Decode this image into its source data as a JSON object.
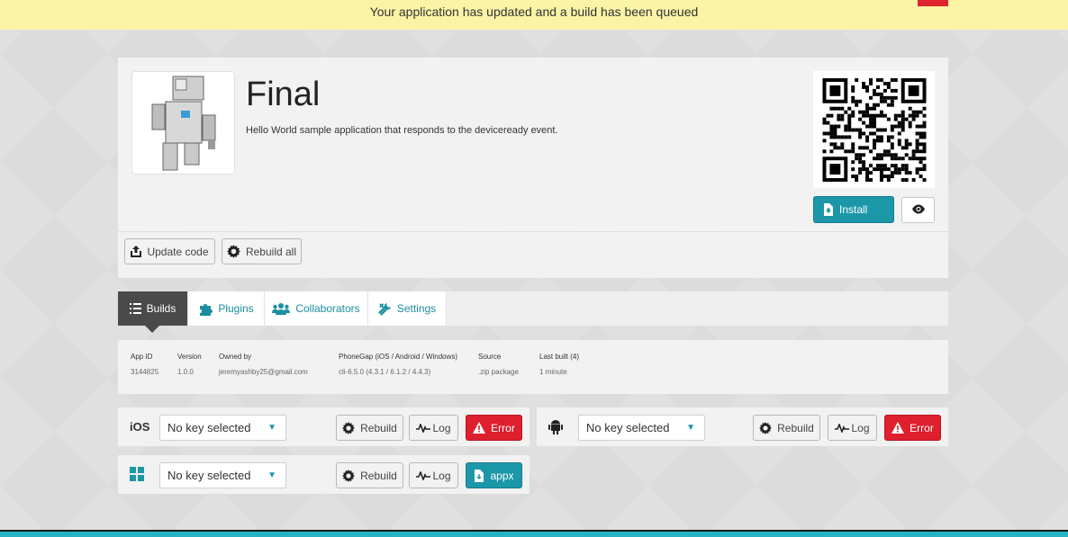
{
  "notice": {
    "message": "Your application has updated and a build has been queued"
  },
  "app": {
    "title": "Final",
    "description": "Hello World sample application that responds to the deviceready event.",
    "install_label": "Install"
  },
  "actions": {
    "update_code": "Update code",
    "rebuild_all": "Rebuild all"
  },
  "tabs": [
    {
      "label": "Builds",
      "icon": "list-icon",
      "active": true
    },
    {
      "label": "Plugins",
      "icon": "puzzle-icon"
    },
    {
      "label": "Collaborators",
      "icon": "people-icon"
    },
    {
      "label": "Settings",
      "icon": "wrench-icon"
    }
  ],
  "info": {
    "app_id": {
      "label": "App ID",
      "value": "3144825"
    },
    "version": {
      "label": "Version",
      "value": "1.0.0"
    },
    "owner": {
      "label": "Owned by",
      "value": "jeremyashby25@gmail.com"
    },
    "phonegap": {
      "label": "PhoneGap (iOS / Android / Windows)",
      "value": "cli-6.5.0 (4.3.1 / 6.1.2 / 4.4.3)"
    },
    "source": {
      "label": "Source",
      "value": ".zip package"
    },
    "last_built": {
      "label": "Last built (4)",
      "value": "1 minute"
    }
  },
  "platforms": {
    "ios": {
      "name": "iOS",
      "key": "No key selected",
      "rebuild": "Rebuild",
      "log": "Log",
      "status": "Error"
    },
    "android": {
      "key": "No key selected",
      "rebuild": "Rebuild",
      "log": "Log",
      "status": "Error"
    },
    "windows": {
      "key": "No key selected",
      "rebuild": "Rebuild",
      "log": "Log",
      "download": "appx"
    }
  },
  "colors": {
    "accent": "#1c97a8",
    "error": "#de1f2e",
    "notice_bg": "#fbf4a7"
  }
}
